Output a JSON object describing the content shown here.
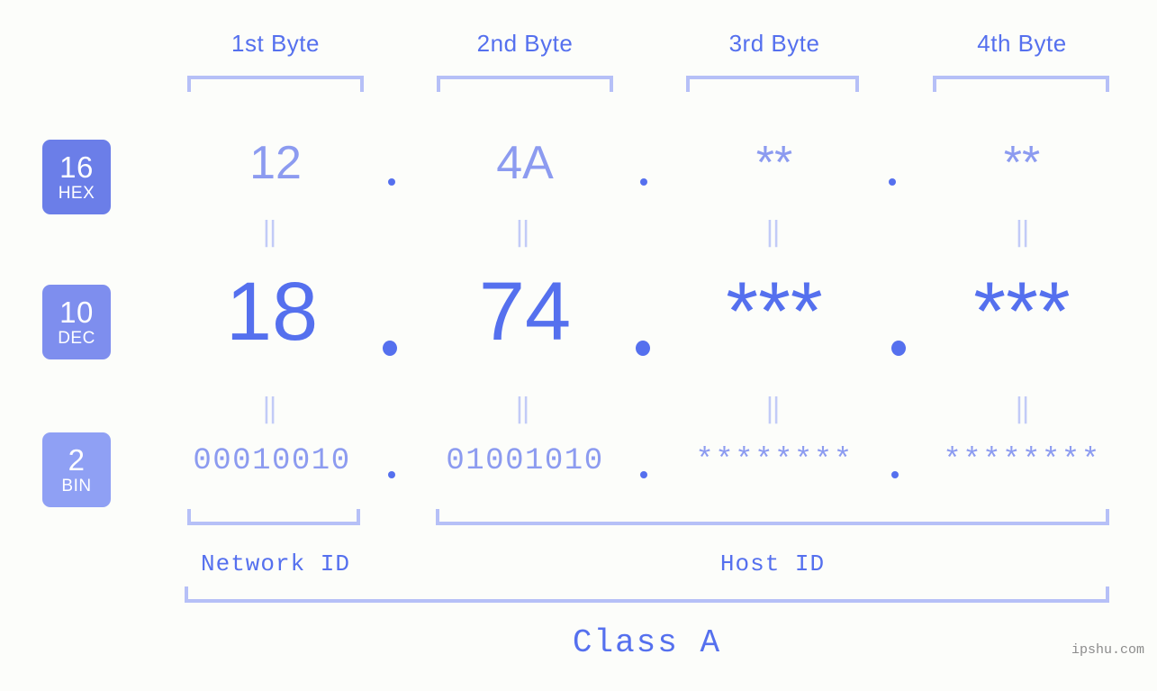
{
  "meta": {
    "watermark": "ipshu.com",
    "background_color": "#fcfdfa",
    "accent_color": "#5570ee",
    "accent_light_color": "#8c9bf0",
    "bracket_color": "#b6c0f7"
  },
  "byte_headers": [
    {
      "label": "1st Byte"
    },
    {
      "label": "2nd Byte"
    },
    {
      "label": "3rd Byte"
    },
    {
      "label": "4th Byte"
    }
  ],
  "rows": [
    {
      "badge_number": "16",
      "badge_label": "HEX",
      "badge_color": "#6b7ee8",
      "values": [
        "12",
        "4A",
        "**",
        "**"
      ],
      "separator": "."
    },
    {
      "badge_number": "10",
      "badge_label": "DEC",
      "badge_color": "#7e8eee",
      "values": [
        "18",
        "74",
        "***",
        "***"
      ],
      "separator": "."
    },
    {
      "badge_number": "2",
      "badge_label": "BIN",
      "badge_color": "#8fa0f4",
      "values": [
        "00010010",
        "01001010",
        "********",
        "********"
      ],
      "separator": "."
    }
  ],
  "equals_marker": "‖",
  "sections": [
    {
      "label": "Network ID"
    },
    {
      "label": "Host ID"
    }
  ],
  "class": {
    "label": "Class A"
  }
}
